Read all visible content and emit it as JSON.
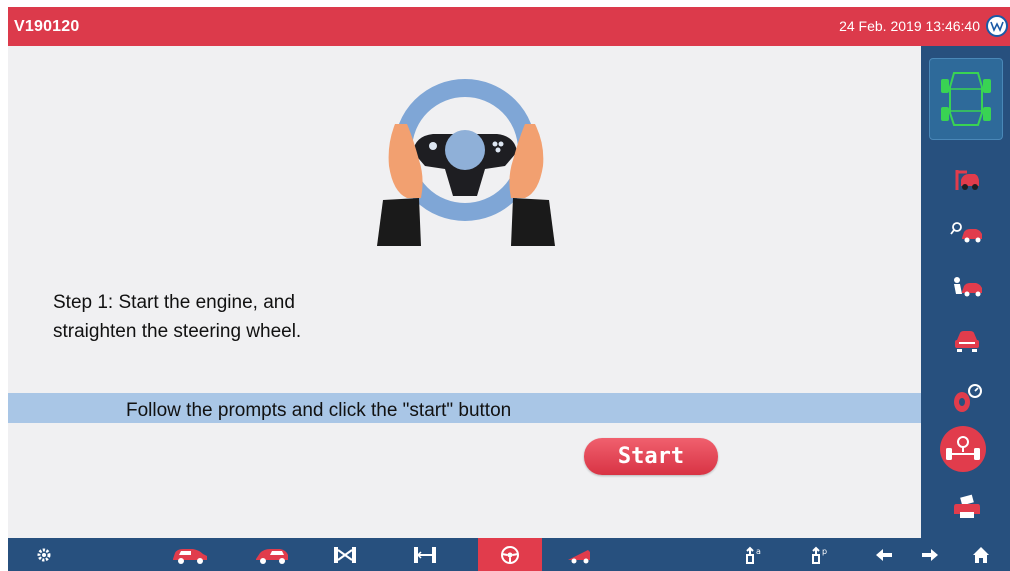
{
  "header": {
    "title": "V190120",
    "datetime": "24 Feb. 2019 13:46:40",
    "brand_logo": "vw-logo",
    "bg_color": "#dc3a4b"
  },
  "main": {
    "illustration": "steering-wheel-hands",
    "step_line1": "Step 1: Start the engine, and",
    "step_line2": "straighten the steering wheel.",
    "prompt": "Follow the prompts and click the \"start\" button",
    "start_label": "Start",
    "prompt_band_color": "#a9c6e6"
  },
  "sidebar": {
    "items": [
      {
        "icon": "car-alignment-diagram-icon"
      },
      {
        "icon": "car-lift-icon"
      },
      {
        "icon": "car-search-icon"
      },
      {
        "icon": "car-mechanic-icon"
      },
      {
        "icon": "car-front-icon"
      },
      {
        "icon": "tire-gauge-icon"
      },
      {
        "icon": "steering-axle-icon",
        "active": true
      },
      {
        "icon": "printer-icon"
      }
    ],
    "bg_color": "#27507e",
    "accent": "#e13c4c"
  },
  "bottombar": {
    "items": [
      {
        "icon": "gear-icon"
      },
      {
        "icon": "car-side-icon"
      },
      {
        "icon": "car-rear-icon"
      },
      {
        "icon": "axle-cross-icon"
      },
      {
        "icon": "axle-measure-icon"
      },
      {
        "icon": "steering-wheel-icon",
        "active": true
      },
      {
        "icon": "car-wedge-icon"
      },
      {
        "icon": "lift-up-icon"
      },
      {
        "icon": "lift-alt-icon"
      },
      {
        "icon": "arrow-left-icon"
      },
      {
        "icon": "arrow-right-icon"
      },
      {
        "icon": "home-icon"
      }
    ]
  }
}
